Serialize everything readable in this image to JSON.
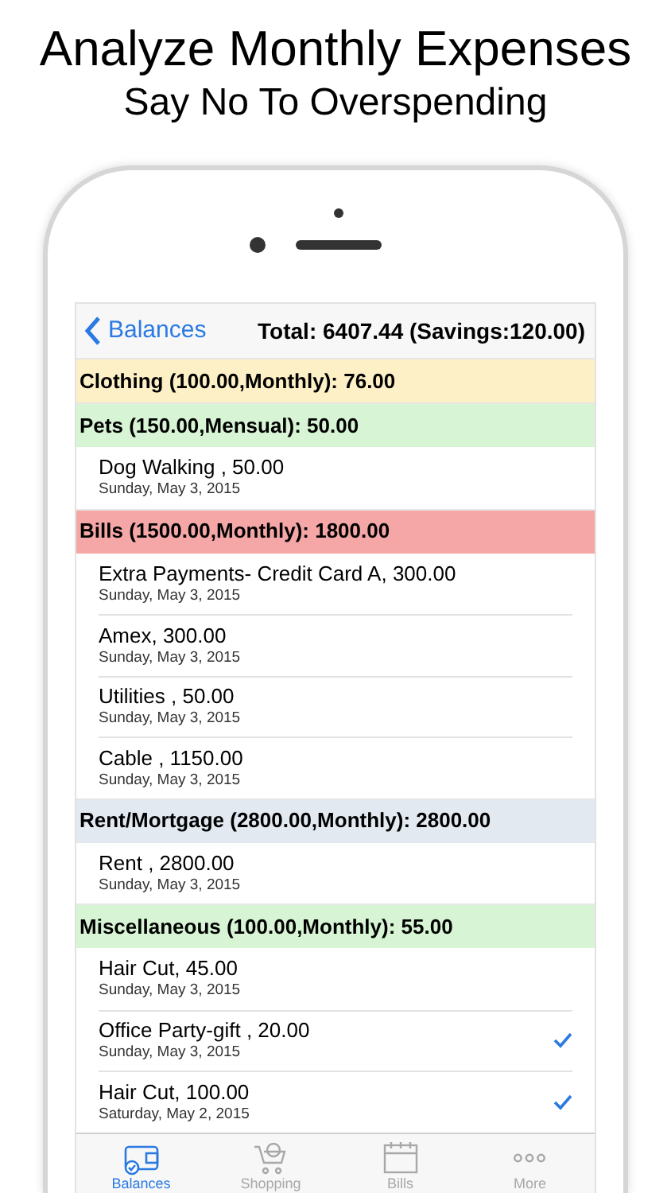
{
  "headline": "Analyze Monthly Expenses",
  "subheadline": "Say No To Overspending",
  "nav": {
    "back": "Balances",
    "title": "Total: 6407.44 (Savings:120.00)"
  },
  "categories": [
    {
      "title": "Clothing (100.00,Monthly): 76.00",
      "color": "#fdf0c6"
    },
    {
      "title": "Pets (150.00,Mensual): 50.00",
      "color": "#d7f5d4",
      "items": [
        {
          "name": "Dog Walking , 50.00",
          "date": "Sunday, May 3, 2015",
          "checked": false
        }
      ]
    },
    {
      "title": "Bills (1500.00,Monthly): 1800.00",
      "color": "#f5a7a7",
      "items": [
        {
          "name": "Extra Payments- Credit Card A, 300.00",
          "date": "Sunday, May 3, 2015",
          "checked": false
        },
        {
          "name": "Amex, 300.00",
          "date": "Sunday, May 3, 2015",
          "checked": false
        },
        {
          "name": "Utilities , 50.00",
          "date": "Sunday, May 3, 2015",
          "checked": false
        },
        {
          "name": "Cable , 1150.00",
          "date": "Sunday, May 3, 2015",
          "checked": false
        }
      ]
    },
    {
      "title": "Rent/Mortgage (2800.00,Monthly): 2800.00",
      "color": "#e2e9f1",
      "items": [
        {
          "name": "Rent , 2800.00",
          "date": "Sunday, May 3, 2015",
          "checked": false
        }
      ]
    },
    {
      "title": "Miscellaneous (100.00,Monthly): 55.00",
      "color": "#d7f5d4",
      "items": [
        {
          "name": "Hair Cut, 45.00",
          "date": "Sunday, May 3, 2015",
          "checked": false
        },
        {
          "name": "Office Party-gift , 20.00",
          "date": "Sunday, May 3, 2015",
          "checked": true
        },
        {
          "name": "Hair Cut, 100.00",
          "date": "Saturday, May 2, 2015",
          "checked": true
        }
      ]
    }
  ],
  "tabs": [
    {
      "kind": "wallet",
      "label": "Balances",
      "selected": true
    },
    {
      "kind": "cart",
      "label": "Shopping",
      "selected": false
    },
    {
      "kind": "calendar",
      "label": "Bills",
      "selected": false
    },
    {
      "kind": "dots",
      "label": "More",
      "selected": false
    }
  ]
}
